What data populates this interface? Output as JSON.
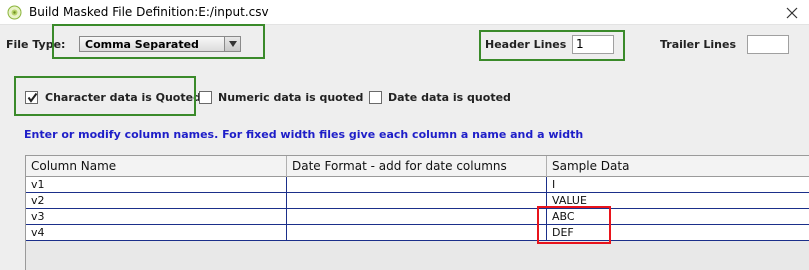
{
  "window": {
    "title": "Build Masked File Definition:E:/input.csv",
    "close_icon": "close-x-icon",
    "app_icon": "java-app-icon"
  },
  "file_type": {
    "label": "File Type:",
    "selected": "Comma Separated"
  },
  "header_lines": {
    "label": "Header Lines",
    "value": "1"
  },
  "trailer_lines": {
    "label": "Trailer Lines",
    "value": ""
  },
  "checkboxes": [
    {
      "label": "Character data is Quoted",
      "checked": true
    },
    {
      "label": "Numeric data is quoted",
      "checked": false
    },
    {
      "label": "Date data is quoted",
      "checked": false
    }
  ],
  "hint": "Enter or modify column names. For fixed width files give each column a name and a width",
  "table": {
    "headers": [
      "Column Name",
      "Date Format - add for date columns",
      "Sample Data"
    ],
    "rows": [
      [
        "v1",
        "",
        "I"
      ],
      [
        "v2",
        "",
        "VALUE"
      ],
      [
        "v3",
        "",
        "ABC"
      ],
      [
        "v4",
        "",
        "DEF"
      ]
    ]
  },
  "colors": {
    "highlight_green": "#3a8a2a",
    "highlight_red": "#e8141c",
    "hint_blue": "#1e1ec8",
    "grid_line": "#1b2f8a"
  }
}
